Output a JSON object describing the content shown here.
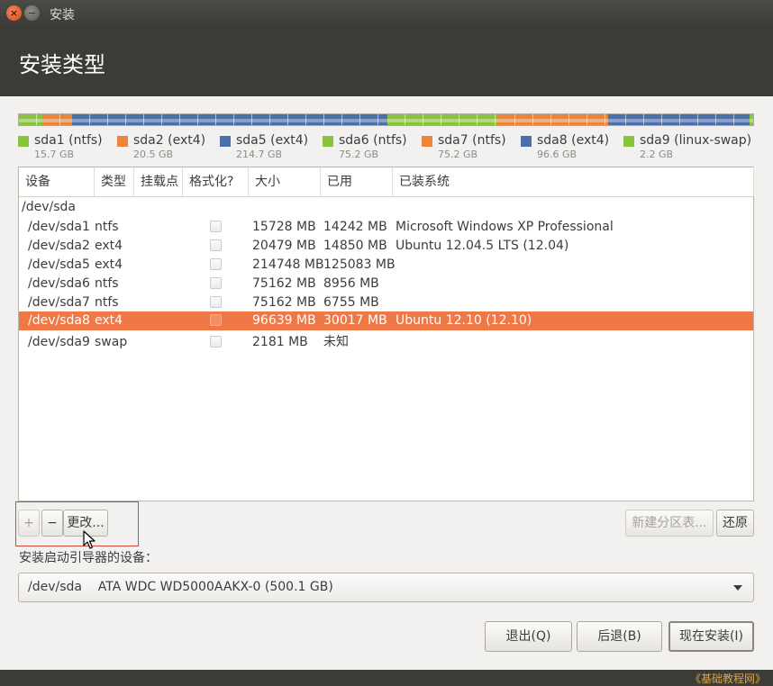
{
  "window": {
    "title": "安装",
    "close_glyph": "×",
    "minimize_glyph": "−"
  },
  "header": {
    "title": "安装类型"
  },
  "partition_bar": [
    {
      "color": "#8ac43f",
      "fraction": 0.0314
    },
    {
      "color": "#e9863a",
      "fraction": 0.0411
    },
    {
      "color": "#4a6fa9",
      "fraction": 0.4293
    },
    {
      "color": "#8ac43f",
      "fraction": 0.1503
    },
    {
      "color": "#e9863a",
      "fraction": 0.1503
    },
    {
      "color": "#4a6fa9",
      "fraction": 0.1932
    },
    {
      "color": "#8ac43f",
      "fraction": 0.0044
    }
  ],
  "legend": [
    {
      "name": "sda1 (ntfs)",
      "size": "15.7 GB",
      "color": "#8ac43f"
    },
    {
      "name": "sda2 (ext4)",
      "size": "20.5 GB",
      "color": "#e9863a"
    },
    {
      "name": "sda5 (ext4)",
      "size": "214.7 GB",
      "color": "#4a6fa9"
    },
    {
      "name": "sda6 (ntfs)",
      "size": "75.2 GB",
      "color": "#8ac43f"
    },
    {
      "name": "sda7 (ntfs)",
      "size": "75.2 GB",
      "color": "#e9863a"
    },
    {
      "name": "sda8 (ext4)",
      "size": "96.6 GB",
      "color": "#4a6fa9"
    },
    {
      "name": "sda9 (linux-swap)",
      "size": "2.2 GB",
      "color": "#8ac43f"
    }
  ],
  "table": {
    "columns": [
      "设备",
      "类型",
      "挂载点",
      "格式化?",
      "大小",
      "已用",
      "已装系统"
    ],
    "disk": "/dev/sda",
    "rows": [
      {
        "device": "/dev/sda1",
        "type": "ntfs",
        "mount": "",
        "format": false,
        "size": "15728 MB",
        "used": "14242 MB",
        "system": "Microsoft Windows XP Professional",
        "selected": false
      },
      {
        "device": "/dev/sda2",
        "type": "ext4",
        "mount": "",
        "format": false,
        "size": "20479 MB",
        "used": "14850 MB",
        "system": "Ubuntu 12.04.5 LTS (12.04)",
        "selected": false
      },
      {
        "device": "/dev/sda5",
        "type": "ext4",
        "mount": "",
        "format": false,
        "size": "214748 MB",
        "used": "125083 MB",
        "system": "",
        "selected": false
      },
      {
        "device": "/dev/sda6",
        "type": "ntfs",
        "mount": "",
        "format": false,
        "size": "75162 MB",
        "used": "8956 MB",
        "system": "",
        "selected": false
      },
      {
        "device": "/dev/sda7",
        "type": "ntfs",
        "mount": "",
        "format": false,
        "size": "75162 MB",
        "used": "6755 MB",
        "system": "",
        "selected": false
      },
      {
        "device": "/dev/sda8",
        "type": "ext4",
        "mount": "",
        "format": false,
        "size": "96639 MB",
        "used": "30017 MB",
        "system": "Ubuntu 12.10 (12.10)",
        "selected": true
      },
      {
        "device": "/dev/sda9",
        "type": "swap",
        "mount": "",
        "format": false,
        "size": "2181 MB",
        "used": "未知",
        "system": "",
        "selected": false
      }
    ]
  },
  "toolbar": {
    "add": "+",
    "remove": "−",
    "change": "更改...",
    "new_table": "新建分区表...",
    "revert": "还原"
  },
  "boot": {
    "label": "安装启动引导器的设备：",
    "selected": "/dev/sda    ATA WDC WD5000AAKX-0 (500.1 GB)"
  },
  "buttons": {
    "quit": "退出(Q)",
    "back": "后退(B)",
    "install": "现在安装(I)"
  },
  "watermark": "《基础教程网》"
}
